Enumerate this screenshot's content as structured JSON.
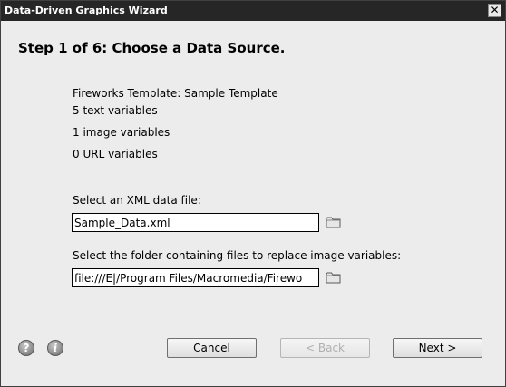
{
  "window": {
    "title": "Data-Driven Graphics Wizard",
    "close_glyph": "✕"
  },
  "step": {
    "title": "Step 1 of 6: Choose a Data Source."
  },
  "template_info": {
    "template_line": "Fireworks Template: Sample Template",
    "text_vars": "5 text variables",
    "image_vars": "1 image variables",
    "url_vars": "0 URL variables"
  },
  "xml_file": {
    "label": "Select an XML data file:",
    "value": "Sample_Data.xml",
    "browse_icon": "folder-icon"
  },
  "image_folder": {
    "label": "Select the folder containing files to replace image variables:",
    "value": "file:///E|/Program Files/Macromedia/Firewo",
    "browse_icon": "folder-icon"
  },
  "footer": {
    "help_icon": "question-icon",
    "info_icon": "info-icon",
    "help_glyph": "?",
    "info_glyph": "i",
    "cancel_label": "Cancel",
    "back_label": "< Back",
    "next_label": "Next >"
  },
  "colors": {
    "titlebar": "#262626",
    "background": "#ececec",
    "disabled_text": "#b0b0b0"
  }
}
